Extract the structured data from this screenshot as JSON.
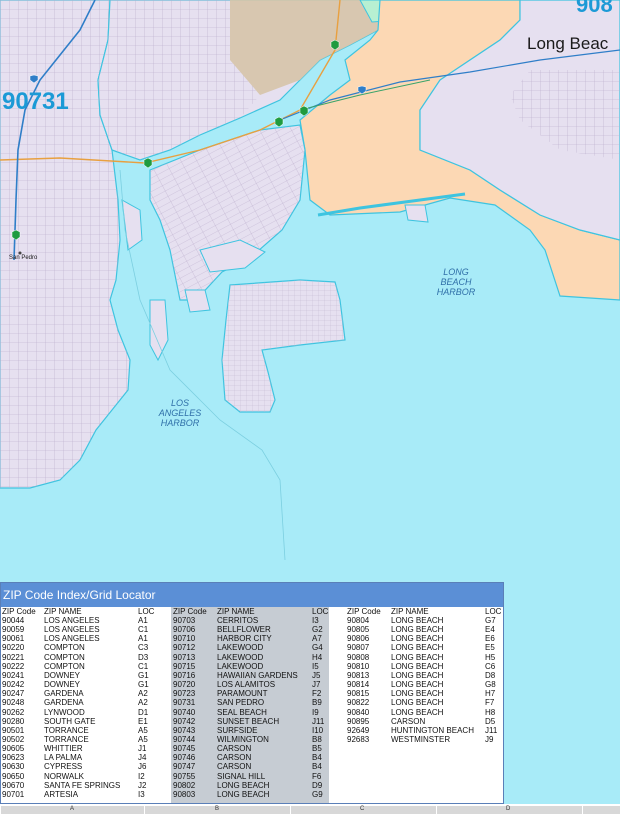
{
  "map": {
    "colors": {
      "water": "#a8ebf8",
      "land_residential": "#e6e0f0",
      "land_industrial": "#d6c4a8",
      "land_port": "#fcd8b4",
      "shore": "#3ec4e0",
      "street": "#b7a9c9",
      "highway": "#e8a040",
      "freeway": "#2f7ec8",
      "zip_label": "#1c9ad6"
    },
    "labels": {
      "zip_left": "90731",
      "zip_top_right": "908",
      "city": "Long Beac",
      "town": "San Pedro",
      "harbor_la": [
        "LOS",
        "ANGELES",
        "HARBOR"
      ],
      "harbor_lb": [
        "LONG",
        "BEACH",
        "HARBOR"
      ]
    },
    "icons": [
      "route-shield-icon",
      "route-shield-icon",
      "route-shield-icon",
      "route-shield-icon",
      "route-shield-icon",
      "freeway-shield-icon",
      "freeway-shield-icon"
    ]
  },
  "index": {
    "title": "ZIP Code Index/Grid Locator",
    "headers": {
      "zip": "ZIP Code",
      "name": "ZIP NAME",
      "loc": "LOC"
    },
    "columns": [
      {
        "rows": [
          [
            "90044",
            "LOS ANGELES",
            "A1"
          ],
          [
            "90059",
            "LOS ANGELES",
            "C1"
          ],
          [
            "90061",
            "LOS ANGELES",
            "A1"
          ],
          [
            "90220",
            "COMPTON",
            "C3"
          ],
          [
            "90221",
            "COMPTON",
            "D3"
          ],
          [
            "90222",
            "COMPTON",
            "C1"
          ],
          [
            "90241",
            "DOWNEY",
            "G1"
          ],
          [
            "90242",
            "DOWNEY",
            "G1"
          ],
          [
            "90247",
            "GARDENA",
            "A2"
          ],
          [
            "90248",
            "GARDENA",
            "A2"
          ],
          [
            "90262",
            "LYNWOOD",
            "D1"
          ],
          [
            "90280",
            "SOUTH GATE",
            "E1"
          ],
          [
            "90501",
            "TORRANCE",
            "A5"
          ],
          [
            "90502",
            "TORRANCE",
            "A5"
          ],
          [
            "90605",
            "WHITTIER",
            "J1"
          ],
          [
            "90623",
            "LA PALMA",
            "J4"
          ],
          [
            "90630",
            "CYPRESS",
            "J6"
          ],
          [
            "90650",
            "NORWALK",
            "I2"
          ],
          [
            "90670",
            "SANTA FE SPRINGS",
            "J2"
          ],
          [
            "90701",
            "ARTESIA",
            "I3"
          ]
        ]
      },
      {
        "rows": [
          [
            "90703",
            "CERRITOS",
            "I3"
          ],
          [
            "90706",
            "BELLFLOWER",
            "G2"
          ],
          [
            "90710",
            "HARBOR CITY",
            "A7"
          ],
          [
            "90712",
            "LAKEWOOD",
            "G4"
          ],
          [
            "90713",
            "LAKEWOOD",
            "H4"
          ],
          [
            "90715",
            "LAKEWOOD",
            "I5"
          ],
          [
            "90716",
            "HAWAIIAN GARDENS",
            "J5"
          ],
          [
            "90720",
            "LOS ALAMITOS",
            "J7"
          ],
          [
            "90723",
            "PARAMOUNT",
            "F2"
          ],
          [
            "90731",
            "SAN PEDRO",
            "B9"
          ],
          [
            "90740",
            "SEAL BEACH",
            "I9"
          ],
          [
            "90742",
            "SUNSET BEACH",
            "J11"
          ],
          [
            "90743",
            "SURFSIDE",
            "I10"
          ],
          [
            "90744",
            "WILMINGTON",
            "B8"
          ],
          [
            "90745",
            "CARSON",
            "B5"
          ],
          [
            "90746",
            "CARSON",
            "B4"
          ],
          [
            "90747",
            "CARSON",
            "B4"
          ],
          [
            "90755",
            "SIGNAL HILL",
            "F6"
          ],
          [
            "90802",
            "LONG BEACH",
            "D9"
          ],
          [
            "90803",
            "LONG BEACH",
            "G9"
          ]
        ]
      },
      {
        "rows": [
          [
            "90804",
            "LONG BEACH",
            "G7"
          ],
          [
            "90805",
            "LONG BEACH",
            "E4"
          ],
          [
            "90806",
            "LONG BEACH",
            "E6"
          ],
          [
            "90807",
            "LONG BEACH",
            "E5"
          ],
          [
            "90808",
            "LONG BEACH",
            "H5"
          ],
          [
            "90810",
            "LONG BEACH",
            "C6"
          ],
          [
            "90813",
            "LONG BEACH",
            "D8"
          ],
          [
            "90814",
            "LONG BEACH",
            "G8"
          ],
          [
            "90815",
            "LONG BEACH",
            "H7"
          ],
          [
            "90822",
            "LONG BEACH",
            "F7"
          ],
          [
            "90840",
            "LONG BEACH",
            "H8"
          ],
          [
            "90895",
            "CARSON",
            "D5"
          ],
          [
            "92649",
            "HUNTINGTON BEACH",
            "J11"
          ],
          [
            "92683",
            "WESTMINSTER",
            "J9"
          ]
        ]
      }
    ]
  },
  "grid": {
    "letters": [
      "A",
      "B",
      "C",
      "D"
    ]
  }
}
